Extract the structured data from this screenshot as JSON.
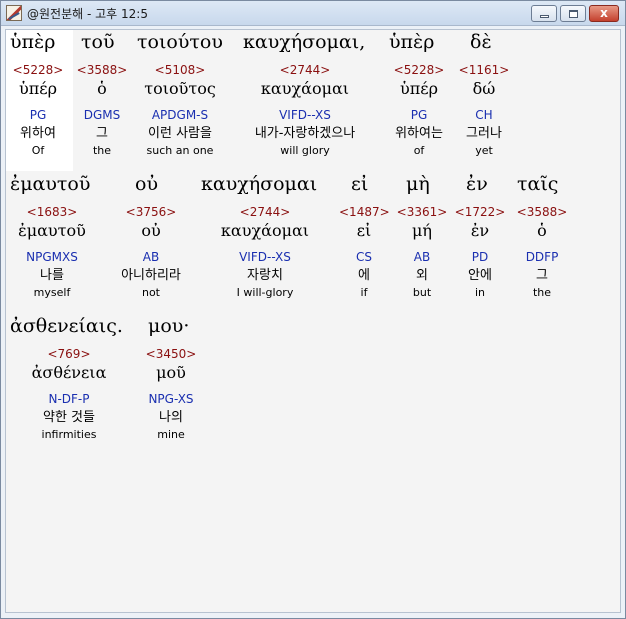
{
  "window": {
    "title": "@원전분해 - 고후 12:5",
    "buttons": {
      "minimize": "",
      "maximize": "",
      "close": "x"
    }
  },
  "words": [
    {
      "surface": "ὑπὲρ",
      "strong": "<5228>",
      "lemma": "ὑπέρ",
      "parse": "PG",
      "korean": "위하여",
      "english": "Of"
    },
    {
      "surface": "τοῦ",
      "strong": "<3588>",
      "lemma": "ὁ",
      "parse": "DGMS",
      "korean": "그",
      "english": "the"
    },
    {
      "surface": "τοιούτου",
      "strong": "<5108>",
      "lemma": "τοιοῦτος",
      "parse": "APDGM-S",
      "korean": "이런 사람을",
      "english": "such an one"
    },
    {
      "surface": "καυχήσομαι,",
      "strong": "<2744>",
      "lemma": "καυχάομαι",
      "parse": "VIFD--XS",
      "korean": "내가-자랑하겠으나",
      "english": "will glory"
    },
    {
      "surface": "ὑπὲρ",
      "strong": "<5228>",
      "lemma": "ὑπέρ",
      "parse": "PG",
      "korean": "위하여는",
      "english": "of"
    },
    {
      "surface": "δὲ",
      "strong": "<1161>",
      "lemma": "δώ",
      "parse": "CH",
      "korean": "그러나",
      "english": "yet"
    },
    {
      "surface": "ἐμαυτοῦ",
      "strong": "<1683>",
      "lemma": "ἐμαυτοῦ",
      "parse": "NPGMXS",
      "korean": "나를",
      "english": "myself"
    },
    {
      "surface": "οὐ",
      "strong": "<3756>",
      "lemma": "οὐ",
      "parse": "AB",
      "korean": "아니하리라",
      "english": "not"
    },
    {
      "surface": "καυχήσομαι",
      "strong": "<2744>",
      "lemma": "καυχάομαι",
      "parse": "VIFD--XS",
      "korean": "자랑치",
      "english": "I will-glory"
    },
    {
      "surface": "εἰ",
      "strong": "<1487>",
      "lemma": "εἰ",
      "parse": "CS",
      "korean": "에",
      "english": "if"
    },
    {
      "surface": "μὴ",
      "strong": "<3361>",
      "lemma": "μή",
      "parse": "AB",
      "korean": "외",
      "english": "but"
    },
    {
      "surface": "ἐν",
      "strong": "<1722>",
      "lemma": "ἐν",
      "parse": "PD",
      "korean": "안에",
      "english": "in"
    },
    {
      "surface": "ταῖς",
      "strong": "<3588>",
      "lemma": "ὁ",
      "parse": "DDFP",
      "korean": "그",
      "english": "the"
    },
    {
      "surface": "ἀσθενείαις.",
      "strong": "<769>",
      "lemma": "ἀσθένεια",
      "parse": "N-DF-P",
      "korean": "약한 것들",
      "english": "infirmities"
    },
    {
      "surface": "μου·",
      "strong": "<3450>",
      "lemma": "μοῦ",
      "parse": "NPG-XS",
      "korean": "나의",
      "english": "mine"
    }
  ]
}
